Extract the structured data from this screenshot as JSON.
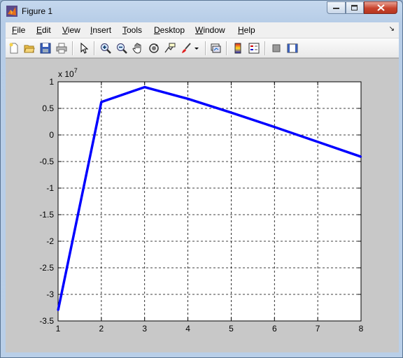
{
  "window": {
    "title": "Figure 1"
  },
  "menu": {
    "items": [
      {
        "pre": "",
        "mn": "F",
        "post": "ile"
      },
      {
        "pre": "",
        "mn": "E",
        "post": "dit"
      },
      {
        "pre": "",
        "mn": "V",
        "post": "iew"
      },
      {
        "pre": "",
        "mn": "I",
        "post": "nsert"
      },
      {
        "pre": "",
        "mn": "T",
        "post": "ools"
      },
      {
        "pre": "",
        "mn": "D",
        "post": "esktop"
      },
      {
        "pre": "",
        "mn": "W",
        "post": "indow"
      },
      {
        "pre": "",
        "mn": "H",
        "post": "elp"
      }
    ]
  },
  "toolbar": {
    "icons": [
      "new-figure-icon",
      "open-file-icon",
      "save-icon",
      "print-icon",
      "edit-plot-arrow-icon",
      "zoom-in-icon",
      "zoom-out-icon",
      "pan-hand-icon",
      "rotate-3d-icon",
      "data-cursor-icon",
      "brush-icon",
      "brush-dropdown-icon",
      "link-plot-icon",
      "colorbar-icon",
      "legend-icon",
      "hide-plot-tools-icon",
      "show-plot-tools-icon"
    ]
  },
  "chart_data": {
    "type": "line",
    "x": [
      1,
      2,
      3,
      4,
      5,
      6,
      7,
      8
    ],
    "series": [
      {
        "values": [
          -33000000,
          6200000,
          9000000,
          6800000,
          4200000,
          1500000,
          -1300000,
          -4100000
        ],
        "color": "#0000ff"
      }
    ],
    "xlim": [
      1,
      8
    ],
    "ylim": [
      -35000000,
      10000000
    ],
    "x_ticks": [
      "1",
      "2",
      "3",
      "4",
      "5",
      "6",
      "7",
      "8"
    ],
    "y_ticks": [
      "1",
      "0.5",
      "0",
      "-0.5",
      "-1",
      "-1.5",
      "-2",
      "-2.5",
      "-3",
      "-3.5"
    ],
    "y_multiplier_base": "x 10",
    "y_multiplier_exp": "7",
    "grid": true,
    "grid_style": "dashed"
  }
}
